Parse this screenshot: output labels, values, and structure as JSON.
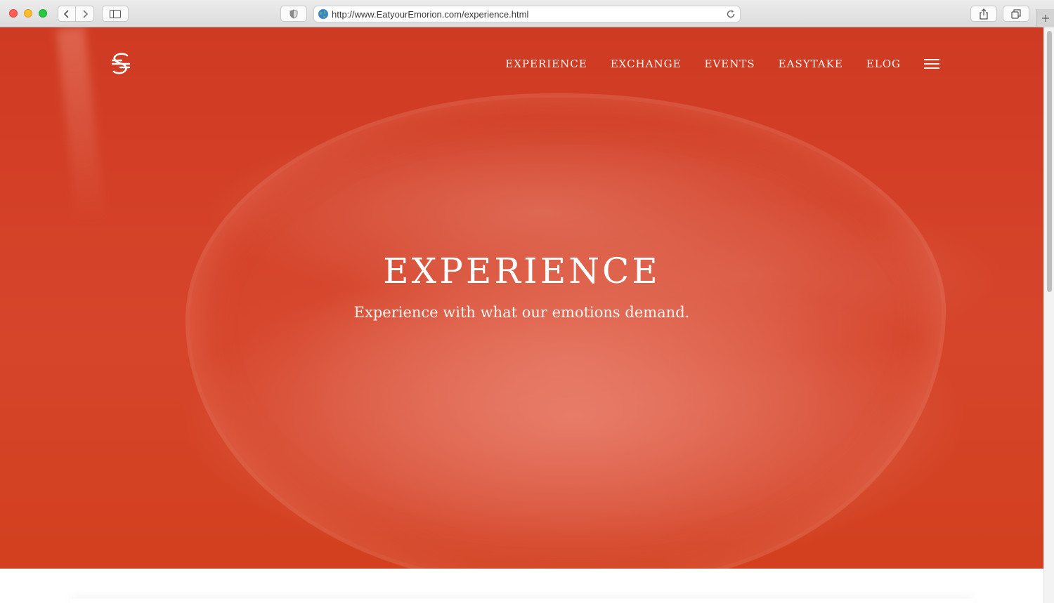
{
  "browser": {
    "url": "http://www.EatyourEmorion.com/experience.html"
  },
  "site": {
    "nav": [
      {
        "label": "EXPERIENCE"
      },
      {
        "label": "EXCHANGE"
      },
      {
        "label": "EVENTS"
      },
      {
        "label": "EASYTAKE"
      },
      {
        "label": "ELOG"
      }
    ],
    "icons": {
      "logo": "s-monogram-logo",
      "menu": "hamburger-menu-icon"
    }
  },
  "hero": {
    "title": "EXPERIENCE",
    "subtitle": "Experience with what our emotions demand."
  },
  "colors": {
    "hero_red": "#d6452b",
    "nav_text": "#fff4f0",
    "traffic_close": "#fe5f57",
    "traffic_minimize": "#febc2e",
    "traffic_zoom": "#28c840"
  }
}
